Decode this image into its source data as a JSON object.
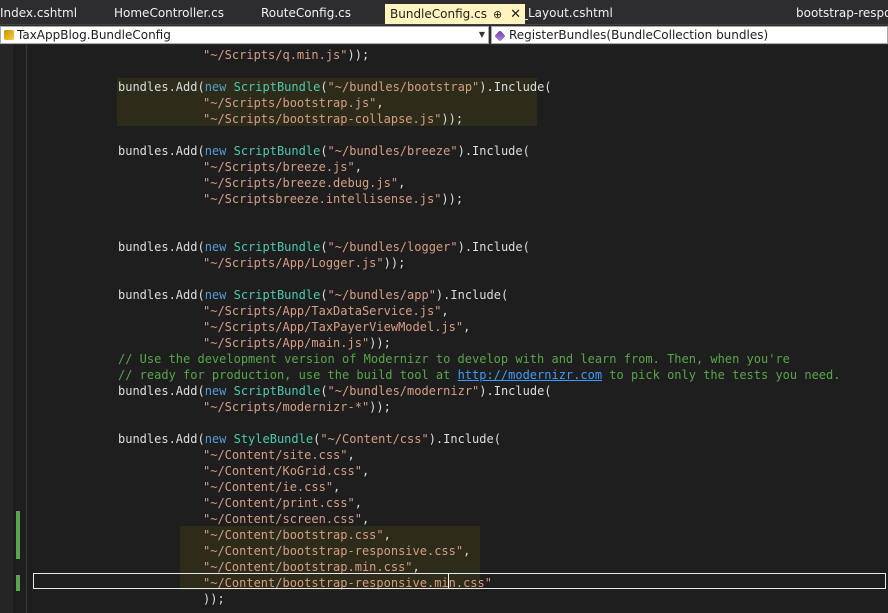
{
  "tabs": [
    {
      "label": "Index.cshtml",
      "active": false
    },
    {
      "label": "HomeController.cs",
      "active": false
    },
    {
      "label": "RouteConfig.cs",
      "active": false
    },
    {
      "label": "BundleConfig.cs",
      "active": true,
      "pin": "⊕",
      "close": "✕"
    },
    {
      "label": "_Layout.cshtml",
      "active": false
    },
    {
      "label": "bootstrap-responsive.css",
      "active": false
    }
  ],
  "navbar": {
    "type_selector": "TaxAppBlog.BundleConfig",
    "member_selector": "RegisterBundles(BundleCollection bundles)",
    "dropdown_glyph": "▼"
  },
  "colors": {
    "background": "#1e1e1e",
    "keyword": "#569cd6",
    "type": "#4ec9b0",
    "string": "#d69d85",
    "comment": "#57a64a",
    "link": "#3d9bff",
    "change_mark": "#57a64a"
  },
  "code": {
    "lines": [
      [
        [
          "str",
          "\"~/Scripts/q.min.js\""
        ],
        [
          "pl",
          "));"
        ]
      ],
      [],
      [
        [
          "pl",
          "bundles.Add("
        ],
        [
          "kw",
          "new "
        ],
        [
          "type",
          "ScriptBundle"
        ],
        [
          "pl",
          "("
        ],
        [
          "str",
          "\"~/bundles/bootstrap\""
        ],
        [
          "pl",
          ").Include("
        ]
      ],
      [
        [
          "str",
          "\"~/Scripts/bootstrap.js\""
        ],
        [
          "pl",
          ","
        ]
      ],
      [
        [
          "str",
          "\"~/Scripts/bootstrap-collapse.js\""
        ],
        [
          "pl",
          "));"
        ]
      ],
      [],
      [
        [
          "pl",
          "bundles.Add("
        ],
        [
          "kw",
          "new "
        ],
        [
          "type",
          "ScriptBundle"
        ],
        [
          "pl",
          "("
        ],
        [
          "str",
          "\"~/bundles/breeze\""
        ],
        [
          "pl",
          ").Include("
        ]
      ],
      [
        [
          "str",
          "\"~/Scripts/breeze.js\""
        ],
        [
          "pl",
          ","
        ]
      ],
      [
        [
          "str",
          "\"~/Scripts/breeze.debug.js\""
        ],
        [
          "pl",
          ","
        ]
      ],
      [
        [
          "str",
          "\"~/Scriptsbreeze.intellisense.js\""
        ],
        [
          "pl",
          "));"
        ]
      ],
      [],
      [],
      [
        [
          "pl",
          "bundles.Add("
        ],
        [
          "kw",
          "new "
        ],
        [
          "type",
          "ScriptBundle"
        ],
        [
          "pl",
          "("
        ],
        [
          "str",
          "\"~/bundles/logger\""
        ],
        [
          "pl",
          ").Include("
        ]
      ],
      [
        [
          "str",
          "\"~/Scripts/App/Logger.js\""
        ],
        [
          "pl",
          "));"
        ]
      ],
      [],
      [
        [
          "pl",
          "bundles.Add("
        ],
        [
          "kw",
          "new "
        ],
        [
          "type",
          "ScriptBundle"
        ],
        [
          "pl",
          "("
        ],
        [
          "str",
          "\"~/bundles/app\""
        ],
        [
          "pl",
          ").Include("
        ]
      ],
      [
        [
          "str",
          "\"~/Scripts/App/TaxDataService.js\""
        ],
        [
          "pl",
          ","
        ]
      ],
      [
        [
          "str",
          "\"~/Scripts/App/TaxPayerViewModel.js\""
        ],
        [
          "pl",
          ","
        ]
      ],
      [
        [
          "str",
          "\"~/Scripts/App/main.js\""
        ],
        [
          "pl",
          "));"
        ]
      ],
      [
        [
          "cm",
          "// Use the development version of Modernizr to develop with and learn from. Then, when you're"
        ]
      ],
      [
        [
          "cm",
          "// ready for production, use the build tool at "
        ],
        [
          "link",
          "http://modernizr.com"
        ],
        [
          "cm",
          " to pick only the tests you need."
        ]
      ],
      [
        [
          "pl",
          "bundles.Add("
        ],
        [
          "kw",
          "new "
        ],
        [
          "type",
          "ScriptBundle"
        ],
        [
          "pl",
          "("
        ],
        [
          "str",
          "\"~/bundles/modernizr\""
        ],
        [
          "pl",
          ").Include("
        ]
      ],
      [
        [
          "str",
          "\"~/Scripts/modernizr-*\""
        ],
        [
          "pl",
          "));"
        ]
      ],
      [],
      [
        [
          "pl",
          "bundles.Add("
        ],
        [
          "kw",
          "new "
        ],
        [
          "type",
          "StyleBundle"
        ],
        [
          "pl",
          "("
        ],
        [
          "str",
          "\"~/Content/css\""
        ],
        [
          "pl",
          ").Include("
        ]
      ],
      [
        [
          "str",
          "\"~/Content/site.css\""
        ],
        [
          "pl",
          ","
        ]
      ],
      [
        [
          "str",
          "\"~/Content/KoGrid.css\""
        ],
        [
          "pl",
          ","
        ]
      ],
      [
        [
          "str",
          "\"~/Content/ie.css\""
        ],
        [
          "pl",
          ","
        ]
      ],
      [
        [
          "str",
          "\"~/Content/print.css\""
        ],
        [
          "pl",
          ","
        ]
      ],
      [
        [
          "str",
          "\"~/Content/screen.css\""
        ],
        [
          "pl",
          ","
        ]
      ],
      [
        [
          "str",
          "\"~/Content/bootstrap.css\""
        ],
        [
          "pl",
          ","
        ]
      ],
      [
        [
          "str",
          "\"~/Content/bootstrap-responsive.css\""
        ],
        [
          "pl",
          ","
        ]
      ],
      [
        [
          "str",
          "\"~/Content/bootstrap.min.css\""
        ],
        [
          "pl",
          ","
        ]
      ],
      [
        [
          "str",
          "\"~/Content/bootstrap-responsive.min.css\""
        ]
      ],
      [
        [
          "pl",
          "));"
        ]
      ]
    ]
  }
}
